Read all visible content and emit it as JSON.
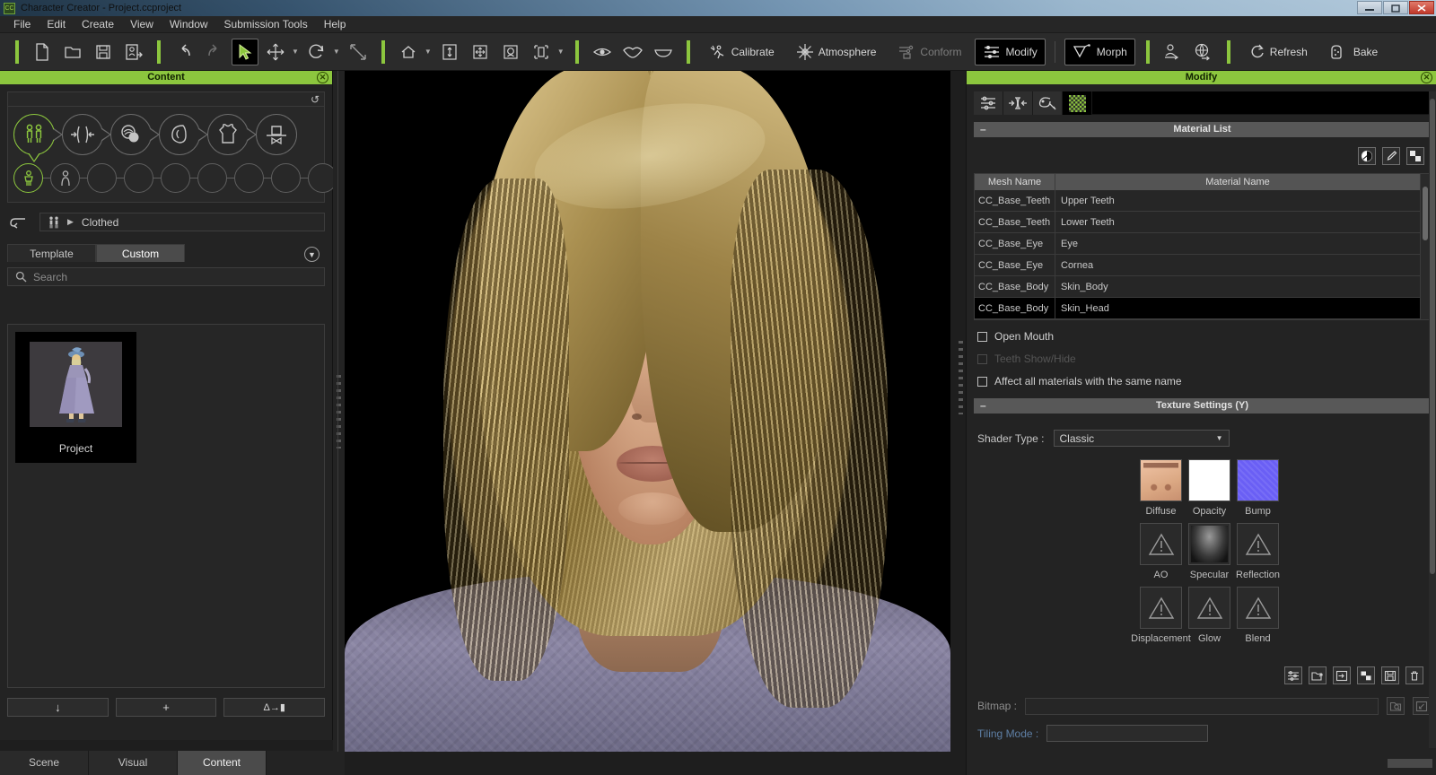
{
  "window": {
    "title": "Character Creator - Project.ccproject",
    "app_icon": "app-icon",
    "minimize": "–",
    "maximize": "❐",
    "close": "✕"
  },
  "menubar": {
    "items": [
      "File",
      "Edit",
      "Create",
      "View",
      "Window",
      "Submission Tools",
      "Help"
    ]
  },
  "toolbar": {
    "groups": [
      {
        "icons": [
          "new-file-icon",
          "open-folder-icon",
          "save-icon",
          "export-icon"
        ]
      },
      {
        "icons": [
          "undo-icon",
          "redo-icon",
          "select-arrow-icon",
          "move-icon",
          "rotate-icon",
          "scale-icon"
        ]
      },
      {
        "icons": [
          "eye-icon",
          "lips-icon",
          "mouth-icon"
        ]
      }
    ],
    "labeled": [
      {
        "label": "Calibrate",
        "icon": "calibrate-icon",
        "state": "normal"
      },
      {
        "label": "Atmosphere",
        "icon": "atmosphere-icon",
        "state": "normal"
      },
      {
        "label": "Conform",
        "icon": "conform-icon",
        "state": "dim"
      },
      {
        "label": "Modify",
        "icon": "modify-icon",
        "state": "active"
      },
      {
        "label": "Morph",
        "icon": "morph-icon",
        "state": "active"
      },
      {
        "label": "Refresh",
        "icon": "refresh-icon",
        "state": "normal"
      },
      {
        "label": "Bake",
        "icon": "bake-icon",
        "state": "normal"
      }
    ],
    "extra_icons": [
      "avatar-export-icon",
      "globe-export-icon"
    ]
  },
  "content_panel": {
    "title": "Content",
    "close_icon": "close-icon",
    "reload_icon": "reload-icon",
    "categories_row1": [
      {
        "name": "category-figure",
        "icon": "two-figures-icon",
        "selected": true
      },
      {
        "name": "category-shape",
        "icon": "shape-arrows-icon",
        "selected": false
      },
      {
        "name": "category-skin",
        "icon": "skin-spheres-icon",
        "selected": false
      },
      {
        "name": "category-head",
        "icon": "head-profile-icon",
        "selected": false
      },
      {
        "name": "category-cloth",
        "icon": "shirt-icon",
        "selected": false
      },
      {
        "name": "category-accessory",
        "icon": "hat-icon",
        "selected": false
      }
    ],
    "categories_row2": [
      {
        "name": "subcategory-clothed",
        "icon": "clothed-figure-icon",
        "selected": true
      },
      {
        "name": "subcategory-nude",
        "icon": "base-figure-icon",
        "selected": false
      },
      {
        "name": "subcategory-empty-1",
        "icon": "",
        "selected": false
      },
      {
        "name": "subcategory-empty-2",
        "icon": "",
        "selected": false
      },
      {
        "name": "subcategory-empty-3",
        "icon": "",
        "selected": false
      },
      {
        "name": "subcategory-empty-4",
        "icon": "",
        "selected": false
      },
      {
        "name": "subcategory-empty-5",
        "icon": "",
        "selected": false
      },
      {
        "name": "subcategory-empty-6",
        "icon": "",
        "selected": false
      },
      {
        "name": "subcategory-empty-7",
        "icon": "",
        "selected": false
      }
    ],
    "breadcrumb": {
      "back_icon": "back-arrow-icon",
      "folder_icon": "figures-icon",
      "arrow": "▶",
      "path": "Clothed"
    },
    "tabs": [
      {
        "label": "Template",
        "active": false
      },
      {
        "label": "Custom",
        "active": true
      }
    ],
    "expand_icon": "chevron-down-icon",
    "search": {
      "icon": "search-icon",
      "placeholder": "Search",
      "value": ""
    },
    "assets": [
      {
        "name": "Project",
        "thumbnail": "female-dress-thumbnail"
      }
    ],
    "buttons": [
      {
        "name": "download-button",
        "glyph": "↓"
      },
      {
        "name": "add-button",
        "glyph": "+"
      },
      {
        "name": "apply-button",
        "glyph": "Δ→▮"
      }
    ]
  },
  "bottom_tabs": [
    {
      "label": "Scene",
      "active": false
    },
    {
      "label": "Visual",
      "active": false
    },
    {
      "label": "Content",
      "active": true
    }
  ],
  "viewport": {
    "name": "3d-viewport",
    "content": "female character head close-up with blonde hair"
  },
  "modify_panel": {
    "title": "Modify",
    "close_icon": "close-icon",
    "tabs": [
      {
        "name": "tab-adjust",
        "icon": "sliders-icon",
        "active": false
      },
      {
        "name": "tab-mesh",
        "icon": "mesh-icon",
        "active": false
      },
      {
        "name": "tab-physics",
        "icon": "physics-icon",
        "active": false
      },
      {
        "name": "tab-material",
        "icon": "checker-icon",
        "active": true
      }
    ],
    "material_list": {
      "header": "Material List",
      "collapse_icon": "minus-icon",
      "tools": [
        {
          "name": "sphere-preview-button",
          "icon": "sphere-icon"
        },
        {
          "name": "eyedropper-button",
          "icon": "eyedropper-icon"
        },
        {
          "name": "checker-button",
          "icon": "checker-icon"
        }
      ],
      "columns": [
        "Mesh Name",
        "Material Name"
      ],
      "rows": [
        {
          "mesh": "CC_Base_Teeth",
          "material": "Upper Teeth",
          "selected": false
        },
        {
          "mesh": "CC_Base_Teeth",
          "material": "Lower Teeth",
          "selected": false
        },
        {
          "mesh": "CC_Base_Eye",
          "material": "Eye",
          "selected": false
        },
        {
          "mesh": "CC_Base_Eye",
          "material": "Cornea",
          "selected": false
        },
        {
          "mesh": "CC_Base_Body",
          "material": "Skin_Body",
          "selected": false
        },
        {
          "mesh": "CC_Base_Body",
          "material": "Skin_Head",
          "selected": true
        }
      ]
    },
    "checkboxes": [
      {
        "label": "Open Mouth",
        "checked": false,
        "disabled": false
      },
      {
        "label": "Teeth Show/Hide",
        "checked": false,
        "disabled": true
      },
      {
        "label": "Affect all materials with the same name",
        "checked": false,
        "disabled": false
      }
    ],
    "texture_settings": {
      "header": "Texture Settings  (Y)",
      "collapse_icon": "minus-icon",
      "shader_label": "Shader Type :",
      "shader_value": "Classic",
      "shader_caret": "▼",
      "channels": [
        {
          "label": "Diffuse",
          "state": "loaded",
          "preview": "skin-diffuse"
        },
        {
          "label": "Opacity",
          "state": "loaded",
          "preview": "white"
        },
        {
          "label": "Bump",
          "state": "loaded",
          "preview": "blue-normal"
        },
        {
          "label": "AO",
          "state": "empty",
          "preview": "warning"
        },
        {
          "label": "Specular",
          "state": "loaded",
          "preview": "gray-spec"
        },
        {
          "label": "Reflection",
          "state": "empty",
          "preview": "warning"
        },
        {
          "label": "Displacement",
          "state": "empty",
          "preview": "warning"
        },
        {
          "label": "Glow",
          "state": "empty",
          "preview": "warning"
        },
        {
          "label": "Blend",
          "state": "empty",
          "preview": "warning"
        }
      ],
      "tool_buttons": [
        {
          "name": "settings-button",
          "icon": "sliders-icon"
        },
        {
          "name": "load-texture-button",
          "icon": "folder-up-icon"
        },
        {
          "name": "import-button",
          "icon": "import-icon"
        },
        {
          "name": "checker-tile-button",
          "icon": "checker-icon"
        },
        {
          "name": "save-button",
          "icon": "floppy-icon"
        },
        {
          "name": "delete-button",
          "icon": "trash-icon"
        }
      ],
      "bitmap_label": "Bitmap :",
      "bitmap_value": "",
      "bitmap_buttons": [
        {
          "name": "browse-bitmap-button",
          "icon": "folder-search-icon"
        },
        {
          "name": "pick-bitmap-button",
          "icon": "pick-icon"
        }
      ],
      "tiling_label": "Tiling Mode :"
    }
  },
  "colors": {
    "accent_green": "#8cc63e",
    "panel_bg": "#232323",
    "toolbar_bg": "#2b2b2b",
    "selected_row": "#000000",
    "section_header": "#585858"
  }
}
